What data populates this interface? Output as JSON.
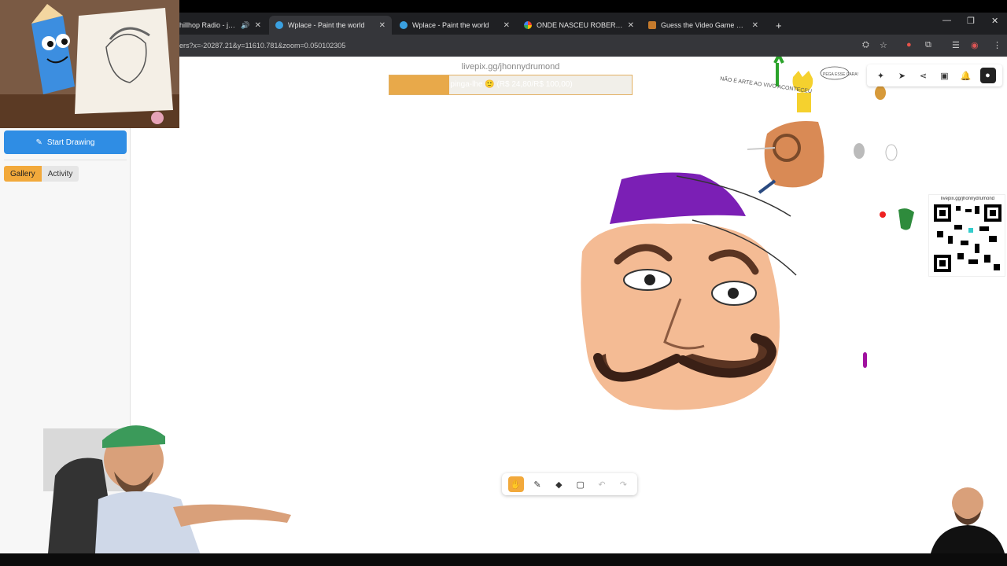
{
  "browser": {
    "tabs": [
      {
        "label": "hillhop Radio - jazzy",
        "active": false
      },
      {
        "label": "Wplace - Paint the world",
        "active": true
      },
      {
        "label": "Wplace - Paint the world",
        "active": false
      },
      {
        "label": "ONDE NASCEU ROBERTO BOL",
        "active": false
      },
      {
        "label": "Guess the Video Game Charact",
        "active": false
      }
    ],
    "new_tab": "+",
    "url": "ers?x=-20287.21&y=11610.781&zoom=0.050102305"
  },
  "sidebar": {
    "start_drawing_label": "Start Drawing",
    "tabs": [
      {
        "label": "Gallery",
        "active": true
      },
      {
        "label": "Activity",
        "active": false
      }
    ]
  },
  "donation": {
    "url": "livepix.gg/jhonnydrumond",
    "text": "pinga-lhe 🙂 (R$ 24,80/R$ 100,00)",
    "raised": 24.8,
    "goal": 100.0,
    "progress": 0.248
  },
  "qr": {
    "label": "livepix.gg/jhonnydrumond"
  },
  "canvas_doodles": {
    "note_1": "PEGA ESSE CARA!",
    "note_2": "NÃO É ARTE AO VIVO ACONTECEU"
  },
  "colors": {
    "accent": "#f2a93b",
    "primary_button": "#2f8de4",
    "hat": "#7b1fb5",
    "skin": "#f4bb94",
    "mustache": "#5a3422"
  },
  "toolbar": {
    "tools": [
      {
        "name": "hand-tool",
        "active": true,
        "disabled": false
      },
      {
        "name": "pencil-tool",
        "active": false,
        "disabled": false
      },
      {
        "name": "eraser-tool",
        "active": false,
        "disabled": false
      },
      {
        "name": "rectangle-tool",
        "active": false,
        "disabled": false
      },
      {
        "name": "undo-tool",
        "active": false,
        "disabled": true
      },
      {
        "name": "redo-tool",
        "active": false,
        "disabled": true
      }
    ]
  }
}
